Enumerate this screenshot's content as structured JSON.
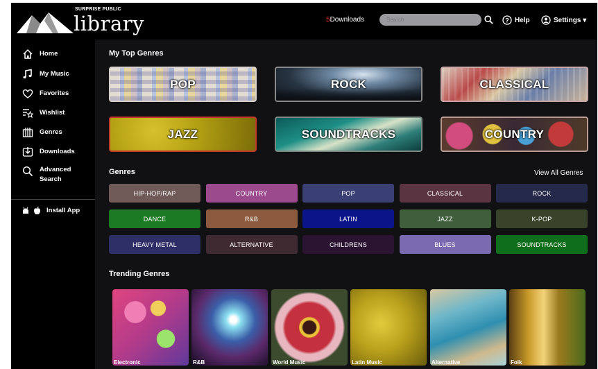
{
  "header": {
    "logo_sub": "SURPRISE PUBLIC",
    "logo_main": "library",
    "downloads_count": "5",
    "downloads_label": "Downloads",
    "search_placeholder": "Search",
    "help_label": "Help",
    "settings_label": "Settings ▾"
  },
  "sidebar": {
    "items": [
      {
        "label": "Home",
        "icon": "home-icon"
      },
      {
        "label": "My Music",
        "icon": "music-note-icon"
      },
      {
        "label": "Favorites",
        "icon": "heart-icon"
      },
      {
        "label": "Wishlist",
        "icon": "wishlist-star-icon"
      },
      {
        "label": "Genres",
        "icon": "genres-icon"
      },
      {
        "label": "Downloads",
        "icon": "download-icon"
      },
      {
        "label": "Advanced",
        "label2": "Search",
        "icon": "search-icon"
      }
    ],
    "install_label": "Install App"
  },
  "top_genres": {
    "heading": "My Top Genres",
    "items": [
      "POP",
      "ROCK",
      "CLASSICAL",
      "JAZZ",
      "SOUNDTRACKS",
      "COUNTRY"
    ]
  },
  "genres": {
    "heading": "Genres",
    "view_all": "View All Genres",
    "pills": [
      {
        "label": "HIP-HOP/RAP",
        "color": "#6f5a57"
      },
      {
        "label": "COUNTRY",
        "color": "#9b4a8e"
      },
      {
        "label": "POP",
        "color": "#3a3f74"
      },
      {
        "label": "CLASSICAL",
        "color": "#5a3440"
      },
      {
        "label": "ROCK",
        "color": "#262a4a"
      },
      {
        "label": "DANCE",
        "color": "#1d7a24"
      },
      {
        "label": "R&B",
        "color": "#8c5a3e"
      },
      {
        "label": "LATIN",
        "color": "#0c1489"
      },
      {
        "label": "JAZZ",
        "color": "#3e5e3c"
      },
      {
        "label": "K-POP",
        "color": "#39432a"
      },
      {
        "label": "HEAVY METAL",
        "color": "#2e2f66"
      },
      {
        "label": "ALTERNATIVE",
        "color": "#402a31"
      },
      {
        "label": "CHILDRENS",
        "color": "#2a1432"
      },
      {
        "label": "BLUES",
        "color": "#7a6ab0"
      },
      {
        "label": "SOUNDTRACKS",
        "color": "#0f6e1c"
      }
    ]
  },
  "trending": {
    "heading": "Trending Genres",
    "items": [
      "Electronic",
      "R&B",
      "World Music",
      "Latin Music",
      "Alternative",
      "Folk"
    ]
  }
}
